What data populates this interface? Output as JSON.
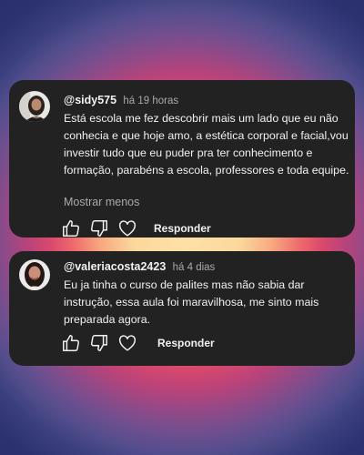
{
  "comments": [
    {
      "username": "@sidy575",
      "time": "há 19 horas",
      "text": "Está escola me fez descobrir mais um lado que eu não conhecia e que hoje amo, a estética corporal e facial,vou investir tudo que eu puder pra ter conhecimento e formação, parabéns a escola, professores e toda equipe.",
      "show_less": "Mostrar menos",
      "reply_label": "Responder",
      "icons": [
        "thumbs-up-icon",
        "thumbs-down-icon",
        "heart-icon"
      ]
    },
    {
      "username": "@valeriacosta2423",
      "time": "há 4 dias",
      "text": "Eu ja tinha o curso de palites mas não sabia dar instrução, essa aula foi maravilhosa, me sinto mais preparada agora.",
      "reply_label": "Responder",
      "icons": [
        "thumbs-up-icon",
        "thumbs-down-icon",
        "heart-icon"
      ]
    }
  ],
  "colors": {
    "card_bg": "#222222",
    "text": "#f1f1f1",
    "muted": "#aaaaaa"
  }
}
